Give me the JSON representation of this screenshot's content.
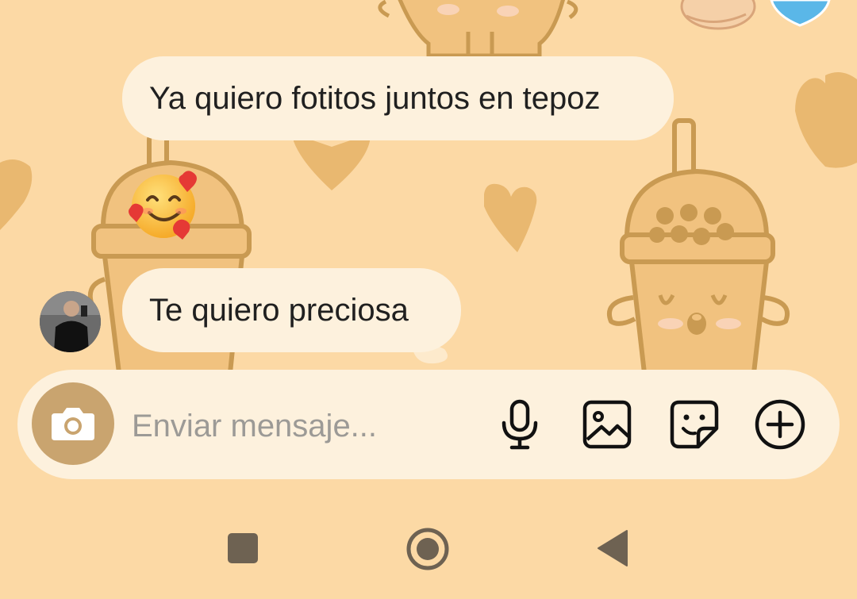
{
  "chat": {
    "messages": [
      {
        "text": "Ya quiero fotitos juntos en tepoz",
        "reaction": "smiling-face-with-hearts"
      },
      {
        "text": "Te quiero preciosa",
        "reaction": ""
      }
    ]
  },
  "composer": {
    "placeholder": "Enviar mensaje...",
    "value": "",
    "icons": [
      "camera-icon",
      "microphone-icon",
      "image-icon",
      "sticker-icon",
      "plus-circle-icon"
    ]
  },
  "theme": {
    "background": "#fcd9a5",
    "bubble": "#fdf1dd",
    "accent": "#c9a46f",
    "pattern": "#e9b870"
  },
  "navigation": {
    "icons": [
      "recents-square-icon",
      "home-circle-icon",
      "back-triangle-icon"
    ]
  }
}
